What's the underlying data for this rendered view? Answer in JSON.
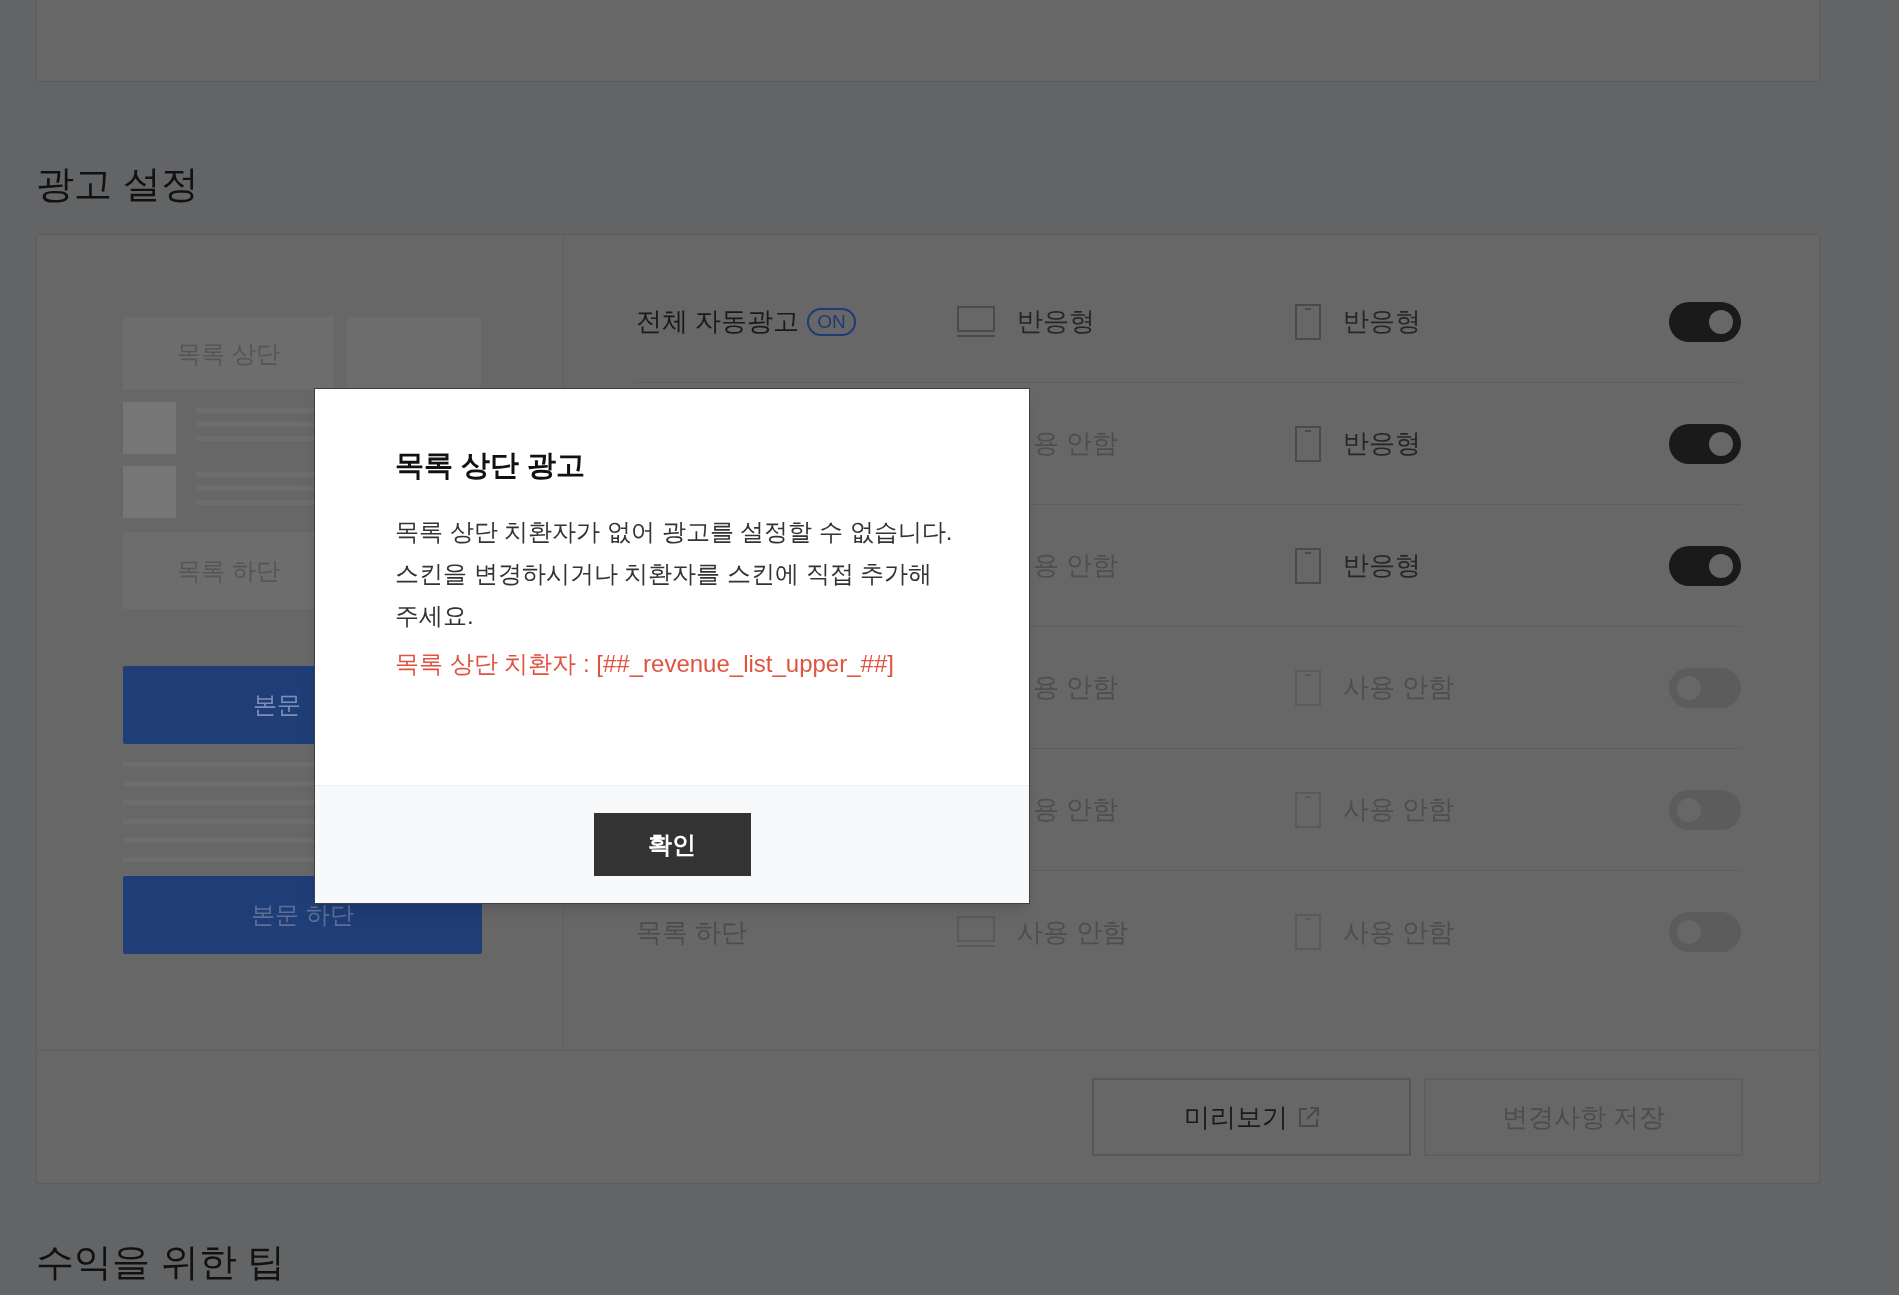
{
  "section_title": "광고 설정",
  "preview": {
    "top": "목록 상단",
    "bottom": "목록 하단",
    "body_top": "본문",
    "body_bottom": "본문 하단"
  },
  "rows": [
    {
      "label": "전체 자동광고",
      "badge": "ON",
      "pc": {
        "text": "반응형",
        "active": true
      },
      "mobile": {
        "text": "반응형",
        "active": true
      },
      "on": true
    },
    {
      "pc": {
        "text": "용 안함",
        "active": false
      },
      "mobile": {
        "text": "반응형",
        "active": true
      },
      "on": true
    },
    {
      "pc": {
        "text": "용 안함",
        "active": false
      },
      "mobile": {
        "text": "반응형",
        "active": true
      },
      "on": true
    },
    {
      "pc": {
        "text": "용 안함",
        "active": false
      },
      "mobile": {
        "text": "사용 안함",
        "active": false
      },
      "on": false
    },
    {
      "pc": {
        "text": "용 안함",
        "active": false
      },
      "mobile": {
        "text": "사용 안함",
        "active": false
      },
      "on": false
    },
    {
      "label": "목록 하단",
      "pc": {
        "text": "사용 안함",
        "active": false
      },
      "mobile": {
        "text": "사용 안함",
        "active": false
      },
      "on": false
    }
  ],
  "footer_buttons": [
    {
      "label": "미리보기",
      "external": true,
      "disabled": false
    },
    {
      "label": "변경사항 저장",
      "external": false,
      "disabled": true
    }
  ],
  "next_section_title": "수익을 위한 팁",
  "modal": {
    "title": "목록 상단 광고",
    "message": "목록 상단 치환자가 없어 광고를 설정할 수 없습니다. 스킨을 변경하시거나 치환자를 스킨에 직접 추가해 주세요.",
    "note": "목록 상단 치환자 : [##_revenue_list_upper_##]",
    "confirm": "확인"
  }
}
